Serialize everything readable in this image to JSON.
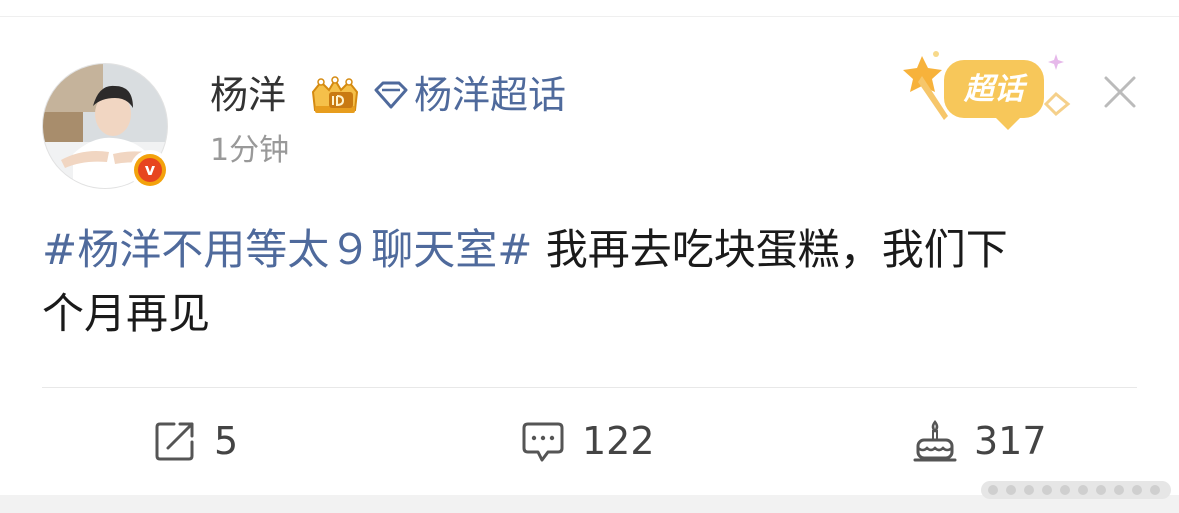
{
  "post": {
    "username": "杨洋",
    "topic_link": "杨洋超话",
    "timestamp": "1分钟",
    "super_badge_label": "超话",
    "hashtag": "#杨洋不用等太９聊天室#",
    "text_line_1": " 我再去吃块蛋糕，我们下",
    "text_line_2": "个月再见"
  },
  "actions": {
    "reposts": "5",
    "comments": "122",
    "likes": "317"
  },
  "colors": {
    "link": "#4f6a9c",
    "text": "#1a1a1a",
    "muted": "#999999",
    "verified_orange": "#f3a20c",
    "verified_red": "#e7451f",
    "badge_yellow": "#f7c75a"
  },
  "icons": {
    "vip": "vip-crown-icon",
    "topic": "diamond-icon",
    "close": "close-icon",
    "share": "share-icon",
    "comment": "comment-icon",
    "like": "cake-like-icon"
  }
}
